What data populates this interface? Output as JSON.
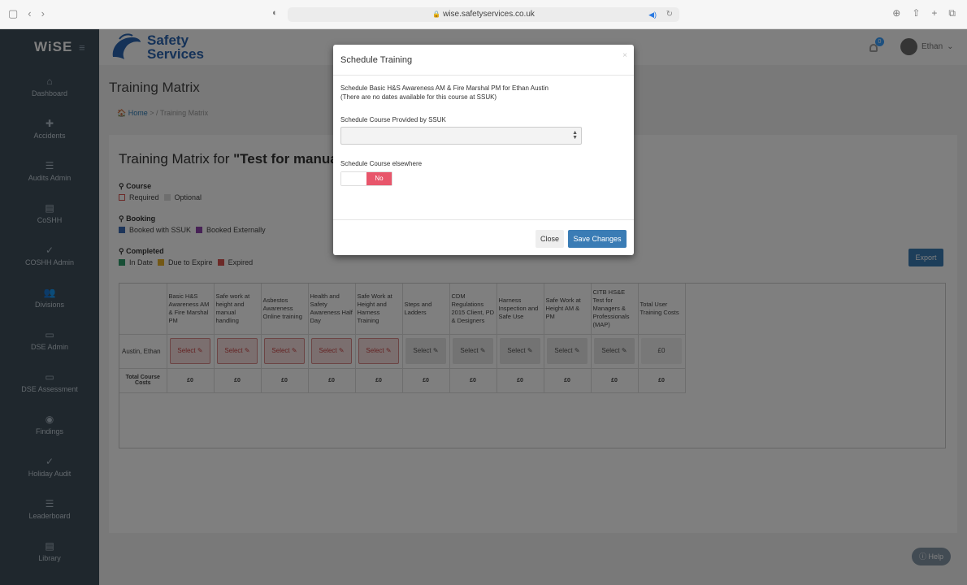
{
  "browser": {
    "url": "wise.safetyservices.co.uk"
  },
  "app": {
    "logo": "WiSE",
    "brand_line1": "Safety",
    "brand_line2": "Services",
    "notification_count": "0",
    "user_name": "Ethan"
  },
  "sidebar": {
    "items": [
      {
        "label": "Dashboard",
        "icon": "dashboard-icon"
      },
      {
        "label": "Accidents",
        "icon": "medical-kit-icon"
      },
      {
        "label": "Audits Admin",
        "icon": "list-icon"
      },
      {
        "label": "CoSHH",
        "icon": "book-icon"
      },
      {
        "label": "COSHH Admin",
        "icon": "check-icon"
      },
      {
        "label": "Divisions",
        "icon": "users-icon"
      },
      {
        "label": "DSE Admin",
        "icon": "monitor-icon"
      },
      {
        "label": "DSE Assessment",
        "icon": "monitor-icon"
      },
      {
        "label": "Findings",
        "icon": "eye-icon"
      },
      {
        "label": "Holiday Audit",
        "icon": "check-icon"
      },
      {
        "label": "Leaderboard",
        "icon": "list-icon"
      },
      {
        "label": "Library",
        "icon": "book-icon"
      }
    ]
  },
  "page": {
    "title": "Training Matrix",
    "breadcrumb_home": "Home",
    "breadcrumb_sep1": ">",
    "breadcrumb_sep2": "/",
    "breadcrumb_current": "Training Matrix",
    "panel_title_prefix": "Training Matrix for ",
    "panel_title_name": "\"Test for manual\"",
    "export_label": "Export",
    "help_label": "Help"
  },
  "legend": {
    "course_heading": "Course",
    "course_items": [
      {
        "label": "Required",
        "color": "#ffffff",
        "border": "#d9534f"
      },
      {
        "label": "Optional",
        "color": "#dddddd",
        "border": "#dddddd"
      }
    ],
    "booking_heading": "Booking",
    "booking_items": [
      {
        "label": "Booked with SSUK",
        "color": "#3a6bb5"
      },
      {
        "label": "Booked Externally",
        "color": "#8e44ad"
      }
    ],
    "completed_heading": "Completed",
    "completed_items": [
      {
        "label": "In Date",
        "color": "#2e9c6a"
      },
      {
        "label": "Due to Expire",
        "color": "#e6b02a"
      },
      {
        "label": "Expired",
        "color": "#d9534f"
      }
    ]
  },
  "matrix": {
    "columns": [
      "Basic H&S Awareness AM & Fire Marshal PM",
      "Safe work at height and manual handling",
      "Asbestos Awareness Online training",
      "Health and Safety Awareness Half Day",
      "Safe Work at Height and Harness Training",
      "Steps and Ladders",
      "CDM Regulations 2015 Client, PD & Designers",
      "Harness Inspection and Safe Use",
      "Safe Work at Height AM & PM",
      "CITB HS&E Test for Managers & Professionals (MAP)",
      "Total User Training Costs"
    ],
    "row_name": "Austin, Ethan",
    "cells": [
      {
        "label": "Select",
        "required": true
      },
      {
        "label": "Select",
        "required": true
      },
      {
        "label": "Select",
        "required": true
      },
      {
        "label": "Select",
        "required": true
      },
      {
        "label": "Select",
        "required": true
      },
      {
        "label": "Select",
        "required": false
      },
      {
        "label": "Select",
        "required": false
      },
      {
        "label": "Select",
        "required": false
      },
      {
        "label": "Select",
        "required": false
      },
      {
        "label": "Select",
        "required": false
      }
    ],
    "row_total": "£0",
    "totals_label": "Total Course Costs",
    "totals": [
      "£0",
      "£0",
      "£0",
      "£0",
      "£0",
      "£0",
      "£0",
      "£0",
      "£0",
      "£0",
      "£0"
    ]
  },
  "modal": {
    "title": "Schedule Training",
    "close_x": "×",
    "line1": "Schedule Basic H&S Awareness AM & Fire Marshal PM for Ethan Austin",
    "line2": "(There are no dates available for this course at SSUK)",
    "select_label": "Schedule Course Provided by SSUK",
    "select_value": "",
    "elsewhere_label": "Schedule Course elsewhere",
    "toggle_label": "No",
    "close_button": "Close",
    "save_button": "Save Changes"
  }
}
